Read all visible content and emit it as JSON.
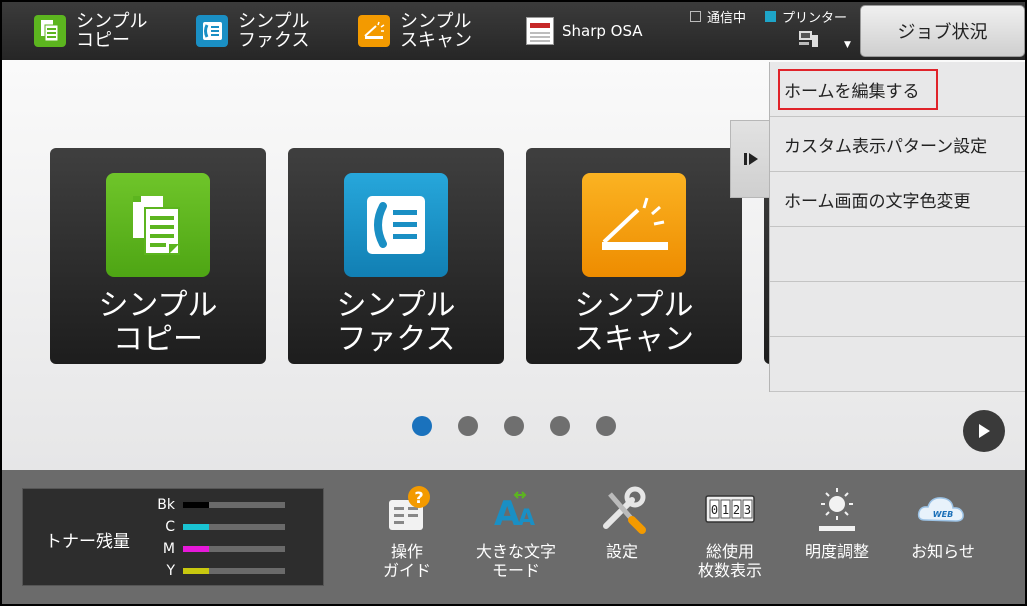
{
  "topbar": {
    "shortcuts": [
      {
        "label": "シンプル\nコピー",
        "icon": "copy-icon"
      },
      {
        "label": "シンプル\nファクス",
        "icon": "fax-icon"
      },
      {
        "label": "シンプル\nスキャン",
        "icon": "scan-icon"
      },
      {
        "label": "Sharp OSA",
        "icon": "osa-icon"
      }
    ],
    "status_comm": "通信中",
    "status_printer": "プリンター",
    "job_status_label": "ジョブ状況"
  },
  "tiles": [
    {
      "label": "シンプル\nコピー",
      "icon": "copy-icon",
      "color": "#5cb51f"
    },
    {
      "label": "シンプル\nファクス",
      "icon": "fax-icon",
      "color": "#1a8fc4"
    },
    {
      "label": "シンプル\nスキャン",
      "icon": "scan-icon",
      "color": "#f39a00"
    }
  ],
  "pager": {
    "count": 5,
    "active": 1
  },
  "menu": {
    "items": [
      {
        "label": "ホームを編集する",
        "highlighted": true
      },
      {
        "label": "カスタム表示パターン設定"
      },
      {
        "label": "ホーム画面の文字色変更"
      },
      {
        "label": ""
      },
      {
        "label": ""
      },
      {
        "label": ""
      }
    ]
  },
  "toner": {
    "title": "トナー残量",
    "colors": [
      {
        "label": "Bk",
        "color": "#000000"
      },
      {
        "label": "C",
        "color": "#19c3d2"
      },
      {
        "label": "M",
        "color": "#e619d9"
      },
      {
        "label": "Y",
        "color": "#c8c80f"
      }
    ]
  },
  "utilities": [
    {
      "label": "操作\nガイド",
      "icon": "operation-guide-icon"
    },
    {
      "label": "大きな文字\nモード",
      "icon": "large-text-icon"
    },
    {
      "label": "設定",
      "icon": "settings-tools-icon"
    },
    {
      "label": "総使用\n枚数表示",
      "icon": "counter-icon"
    },
    {
      "label": "明度調整",
      "icon": "brightness-icon"
    },
    {
      "label": "お知らせ",
      "icon": "web-notice-icon"
    }
  ],
  "colors": {
    "accent_blue": "#1a72bd",
    "highlight_red": "#e0232a"
  }
}
